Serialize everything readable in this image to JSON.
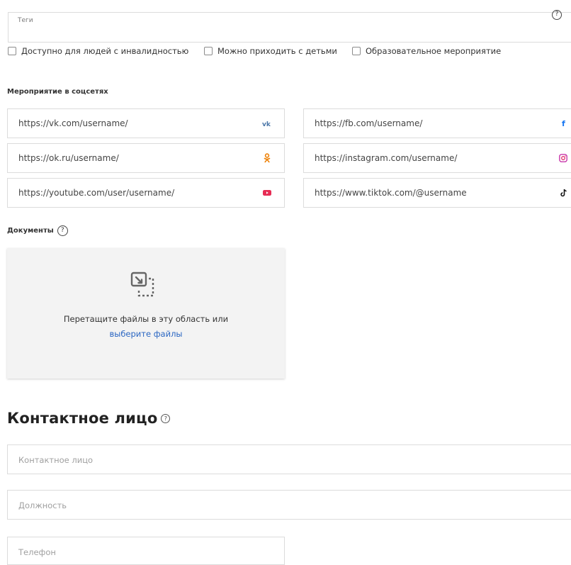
{
  "tags": {
    "label": "Теги",
    "help": "?"
  },
  "checkboxes": [
    {
      "label": "Доступно для людей с инвалидностью",
      "checked": false
    },
    {
      "label": "Можно приходить с детьми",
      "checked": false
    },
    {
      "label": "Образовательное мероприятие",
      "checked": false
    }
  ],
  "social": {
    "title": "Мероприятие в соцсетях",
    "left": [
      {
        "value": "https://vk.com/username/",
        "icon": "vk-icon"
      },
      {
        "value": "https://ok.ru/username/",
        "icon": "ok-icon"
      },
      {
        "value": "https://youtube.com/user/username/",
        "icon": "youtube-icon"
      }
    ],
    "right": [
      {
        "value": "https://fb.com/username/",
        "icon": "facebook-icon"
      },
      {
        "value": "https://instagram.com/username/",
        "icon": "instagram-icon"
      },
      {
        "value": "https://www.tiktok.com/@username",
        "icon": "tiktok-icon"
      }
    ]
  },
  "documents": {
    "title": "Документы",
    "help": "?",
    "drop_text": "Перетащите файлы в эту область или",
    "drop_link": "выберите файлы"
  },
  "contact": {
    "title": "Контактное лицо",
    "help": "?",
    "name_placeholder": "Контактное лицо",
    "position_placeholder": "Должность",
    "phone_placeholder": "Телефон"
  },
  "colors": {
    "vk": "#4a76a8",
    "ok": "#ee8208",
    "youtube": "#e62c54",
    "facebook": "#1877f2",
    "instagram": "#c837ab",
    "link": "#2a66c2"
  }
}
